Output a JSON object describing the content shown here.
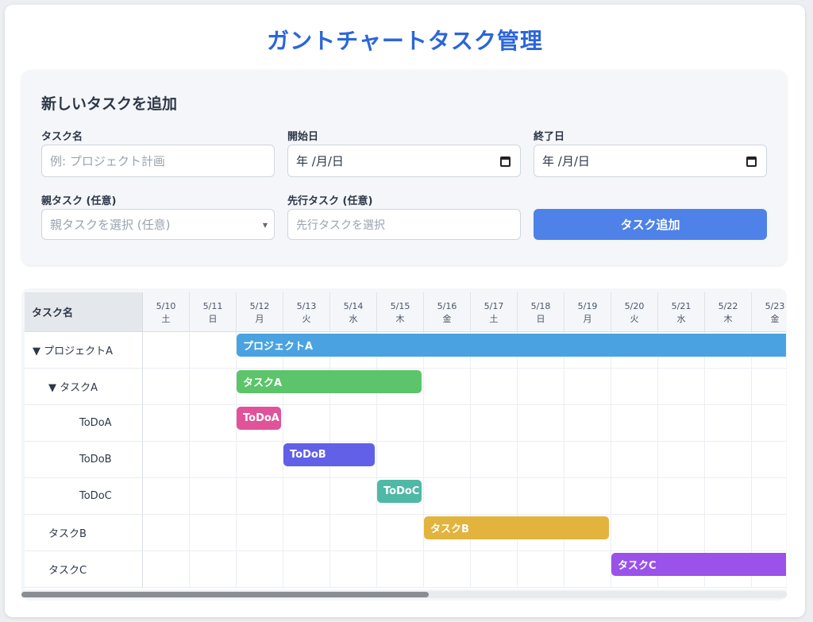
{
  "page": {
    "title": "ガントチャートタスク管理"
  },
  "form": {
    "heading": "新しいタスクを追加",
    "task_name_label": "タスク名",
    "task_name_placeholder": "例: プロジェクト計画",
    "start_label": "開始日",
    "start_value": "年 /月/日",
    "end_label": "終了日",
    "end_value": "年 /月/日",
    "parent_label": "親タスク (任意)",
    "parent_placeholder": "親タスクを選択 (任意)",
    "predecessor_label": "先行タスク (任意)",
    "predecessor_placeholder": "先行タスクを選択",
    "add_button": "タスク追加",
    "icons": {
      "calendar": "calendar-icon",
      "select_arrow": "chevron-down-icon"
    }
  },
  "gantt": {
    "name_header": "タスク名",
    "days": [
      {
        "date": "5/10",
        "dow": "土"
      },
      {
        "date": "5/11",
        "dow": "日"
      },
      {
        "date": "5/12",
        "dow": "月"
      },
      {
        "date": "5/13",
        "dow": "火"
      },
      {
        "date": "5/14",
        "dow": "水"
      },
      {
        "date": "5/15",
        "dow": "木"
      },
      {
        "date": "5/16",
        "dow": "金"
      },
      {
        "date": "5/17",
        "dow": "土"
      },
      {
        "date": "5/18",
        "dow": "日"
      },
      {
        "date": "5/19",
        "dow": "月"
      },
      {
        "date": "5/20",
        "dow": "火"
      },
      {
        "date": "5/21",
        "dow": "水"
      },
      {
        "date": "5/22",
        "dow": "木"
      },
      {
        "date": "5/23",
        "dow": "金"
      }
    ],
    "rows": [
      {
        "name": "▼ プロジェクトA",
        "level": 0,
        "bar_label": "プロジェクトA",
        "start": "5/12",
        "end": "5/23+",
        "color": "#4aa3e0"
      },
      {
        "name": "▼ タスクA",
        "level": 1,
        "bar_label": "タスクA",
        "start": "5/12",
        "end": "5/15",
        "color": "#5cc46a"
      },
      {
        "name": "ToDoA",
        "level": 2,
        "bar_label": "ToDoA",
        "start": "5/12",
        "end": "5/12",
        "color": "#e0529a"
      },
      {
        "name": "ToDoB",
        "level": 2,
        "bar_label": "ToDoB",
        "start": "5/13",
        "end": "5/14",
        "color": "#6160e6"
      },
      {
        "name": "ToDoC",
        "level": 2,
        "bar_label": "ToDoC",
        "start": "5/15",
        "end": "5/15",
        "color": "#4fb8a6"
      },
      {
        "name": "タスクB",
        "level": 1,
        "bar_label": "タスクB",
        "start": "5/16",
        "end": "5/19",
        "color": "#e2b43e"
      },
      {
        "name": "タスクC",
        "level": 1,
        "bar_label": "タスクC",
        "start": "5/20",
        "end": "5/23+",
        "color": "#9a52ea"
      }
    ],
    "scroll_position": 0
  }
}
